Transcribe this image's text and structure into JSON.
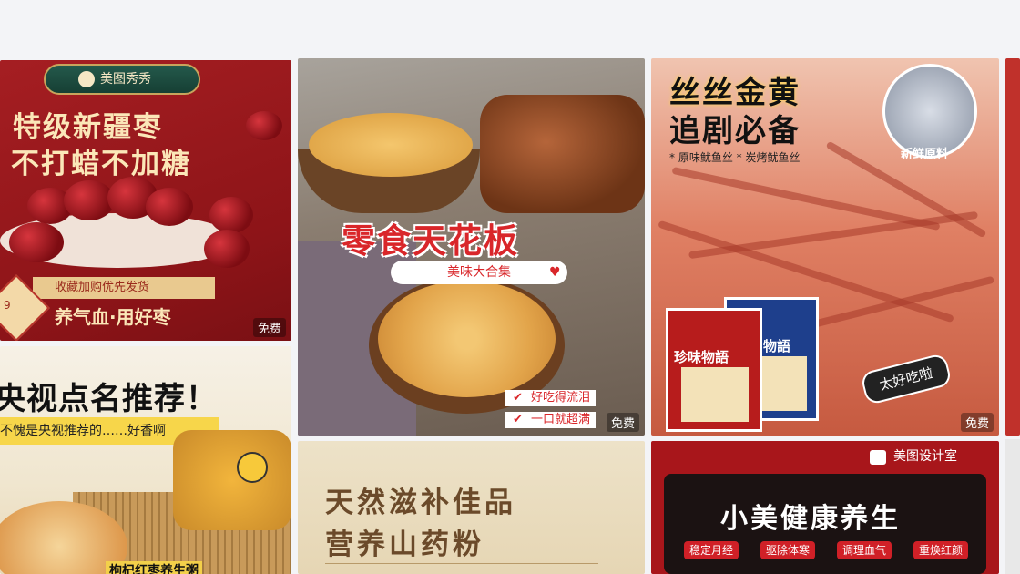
{
  "cards": {
    "dates": {
      "brand": "美图秀秀",
      "title_line1": "特级新疆枣",
      "title_line2": "不打蜡不加糖",
      "ribbon": "收藏加购优先发货",
      "slogan": "养气血·用好枣",
      "badge": "9",
      "free": "免费"
    },
    "snacks": {
      "title": "零食天花板",
      "pill": "美味大合集",
      "tag1": "好吃得流泪",
      "tag2": "一口就超满",
      "free": "免费"
    },
    "squid": {
      "title_line1": "丝丝金黄",
      "title_line2": "追剧必备",
      "sub": "* 原味鱿鱼丝  * 炭烤鱿鱼丝",
      "fresh": "新鲜原料",
      "pack1": "珍味物語",
      "pack2": "物語",
      "bubble": "太好吃啦",
      "free": "免费"
    },
    "cctv": {
      "title": "央视点名推荐！",
      "sub": "不愧是央视推荐的……好香啊",
      "label": "枸杞红枣养生粥"
    },
    "yam": {
      "title_line1": "天然滋补佳品",
      "title_line2": "营养山药粉"
    },
    "health": {
      "brand": "美图设计室",
      "title": "小美健康养生",
      "chips": [
        "稳定月经",
        "驱除体寒",
        "调理血气",
        "重焕红颜"
      ]
    }
  }
}
